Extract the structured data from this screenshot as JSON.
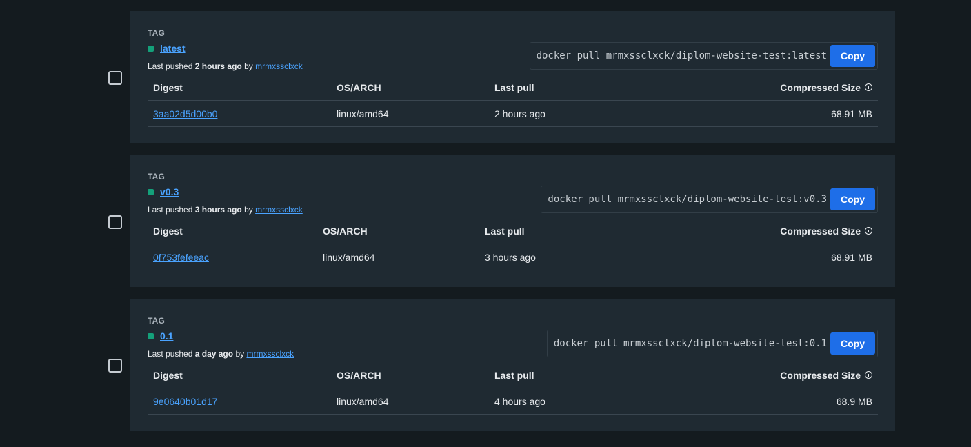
{
  "tags": [
    {
      "tag_label": "TAG",
      "tag_name": "latest",
      "pushed_prefix": "Last pushed",
      "pushed_time": "2 hours ago",
      "pushed_by": "by",
      "pushed_user": "mrmxssclxck",
      "pull_command": "docker pull mrmxssclxck/diplom-website-test:latest",
      "copy_label": "Copy",
      "columns": {
        "digest": "Digest",
        "os_arch": "OS/ARCH",
        "last_pull": "Last pull",
        "size": "Compressed Size"
      },
      "rows": [
        {
          "digest": "3aa02d5d00b0",
          "os_arch": "linux/amd64",
          "last_pull": "2 hours ago",
          "size": "68.91 MB"
        }
      ]
    },
    {
      "tag_label": "TAG",
      "tag_name": "v0.3",
      "pushed_prefix": "Last pushed",
      "pushed_time": "3 hours ago",
      "pushed_by": "by",
      "pushed_user": "mrmxssclxck",
      "pull_command": "docker pull mrmxssclxck/diplom-website-test:v0.3",
      "copy_label": "Copy",
      "columns": {
        "digest": "Digest",
        "os_arch": "OS/ARCH",
        "last_pull": "Last pull",
        "size": "Compressed Size"
      },
      "rows": [
        {
          "digest": "0f753fefeeac",
          "os_arch": "linux/amd64",
          "last_pull": "3 hours ago",
          "size": "68.91 MB"
        }
      ]
    },
    {
      "tag_label": "TAG",
      "tag_name": "0.1",
      "pushed_prefix": "Last pushed",
      "pushed_time": "a day ago",
      "pushed_by": "by",
      "pushed_user": "mrmxssclxck",
      "pull_command": "docker pull mrmxssclxck/diplom-website-test:0.1",
      "copy_label": "Copy",
      "columns": {
        "digest": "Digest",
        "os_arch": "OS/ARCH",
        "last_pull": "Last pull",
        "size": "Compressed Size"
      },
      "rows": [
        {
          "digest": "9e0640b01d17",
          "os_arch": "linux/amd64",
          "last_pull": "4 hours ago",
          "size": "68.9 MB"
        }
      ]
    }
  ],
  "colors": {
    "background": "#141b1f",
    "card": "#1f2a32",
    "link": "#4aa3ff",
    "status_dot": "#14a07a",
    "copy_button": "#1e6ee8"
  },
  "icons": {
    "status": "status-dot-icon",
    "info": "info-circle-icon",
    "checkbox": "checkbox-unchecked-icon"
  }
}
